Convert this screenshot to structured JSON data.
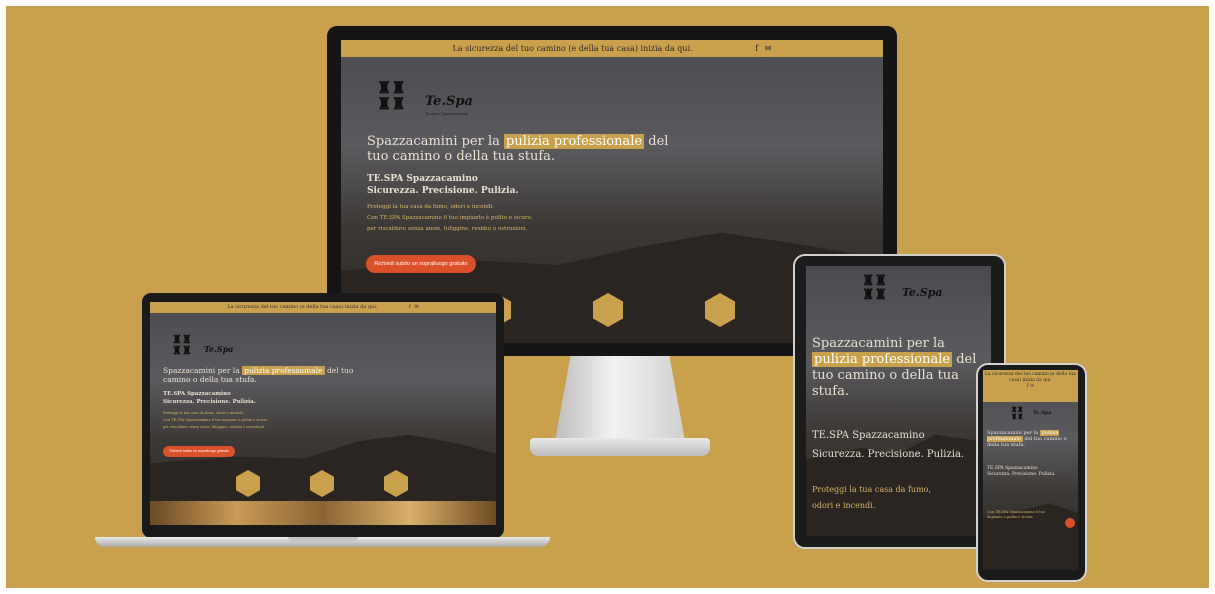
{
  "site": {
    "top_bar": "La sicurezza del tuo camino (e della tua casa) inizia da qui.",
    "logo_name": "Te.Spa",
    "logo_sub": "Tecnici Spazzacamini",
    "headline_part1": "Spazzacamini per la",
    "headline_highlight": "pulizia professionale",
    "headline_part2": "del tuo camino o della tua stufa.",
    "subhead_brand": "TE.SPA Spazzacamino",
    "subhead_tagline": "Sicurezza. Precisione. Pulizia.",
    "body_gold": "Proteggi la tua casa da fumo, odori e incendi.",
    "body_line1": "Con TE.SPA Spazzacamino il tuo impianto è pulito e sicuro,",
    "body_line2": "per riscaldare senza ansie, fuliggine, residui o ostruzioni.",
    "cta": "Richiedi subito un sopralluogo gratuito"
  },
  "colors": {
    "background": "#c9a14d",
    "accent": "#c9a14d",
    "cta": "#d9502a"
  },
  "icons": {
    "social": [
      "facebook-icon",
      "email-icon"
    ],
    "features": [
      "shield-icon",
      "chimney-icon",
      "broom-icon"
    ]
  }
}
